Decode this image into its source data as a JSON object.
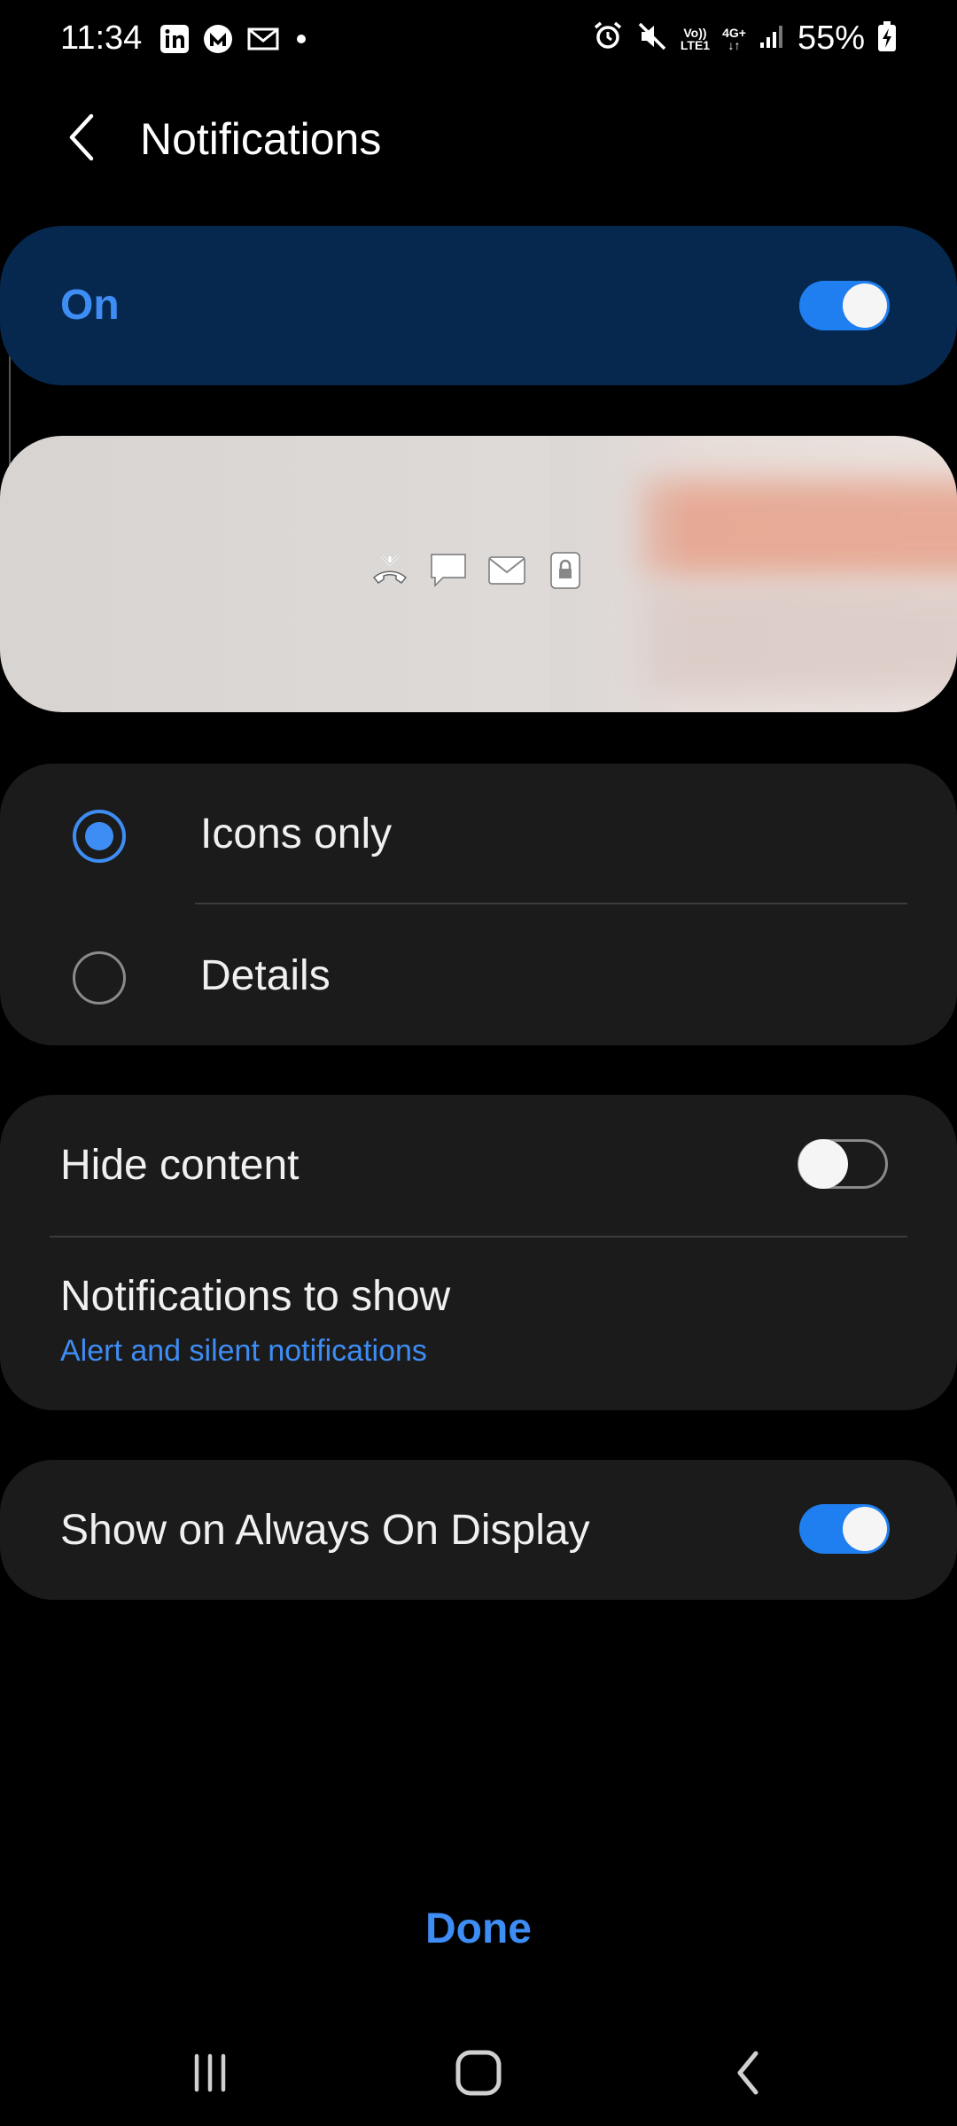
{
  "status_bar": {
    "time": "11:34",
    "left_icons": [
      "linkedin-icon",
      "m-app-icon",
      "gmail-icon",
      "dot-icon"
    ],
    "right_icons": [
      "alarm-icon",
      "mute-icon",
      "volte-icon",
      "network-4g-icon",
      "signal-icon",
      "battery-charging-icon"
    ],
    "volte_text": [
      "Vo))",
      "LTE1"
    ],
    "net_text": [
      "4G+",
      "↓↑"
    ],
    "battery": "55%"
  },
  "header": {
    "title": "Notifications",
    "back_icon": "chevron-left-icon"
  },
  "master": {
    "label": "On",
    "enabled": true
  },
  "preview": {
    "icons": [
      "missed-call-icon",
      "message-icon",
      "mail-icon",
      "lock-icon"
    ]
  },
  "style_options": {
    "selected": "Icons only",
    "items": [
      {
        "label": "Icons only",
        "selected": true
      },
      {
        "label": "Details",
        "selected": false
      }
    ]
  },
  "content_settings": {
    "hide_content_label": "Hide content",
    "hide_content_enabled": false,
    "notifications_to_show_label": "Notifications to show",
    "notifications_to_show_value": "Alert and silent notifications"
  },
  "aod": {
    "label": "Show on Always On Display",
    "enabled": true
  },
  "footer": {
    "done_label": "Done"
  },
  "nav_bar": {
    "icons": [
      "recent-apps-icon",
      "home-icon",
      "back-icon"
    ]
  },
  "colors": {
    "accent": "#3e8df5",
    "toggle_on": "#1f7ff0",
    "on_card_bg": "#06284f",
    "card_bg": "#1b1b1b"
  }
}
